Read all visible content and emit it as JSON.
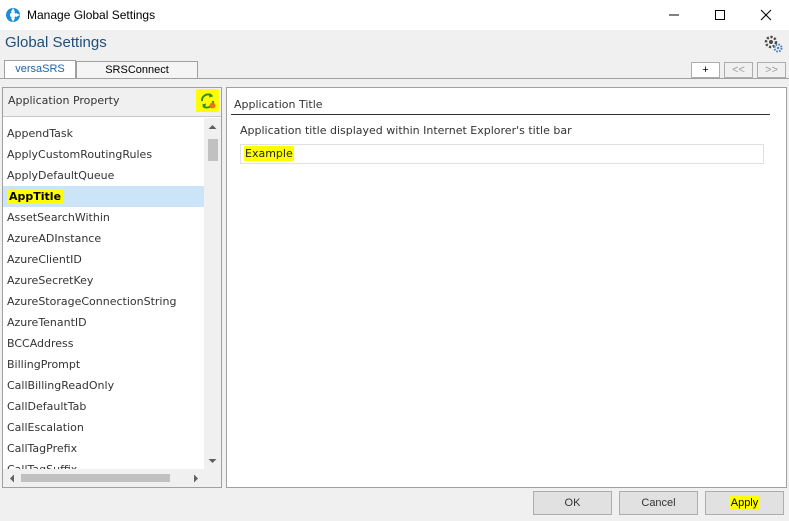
{
  "window": {
    "title": "Manage Global Settings",
    "icon": "versasrs-logo-icon",
    "controls": [
      "minimize-icon",
      "maximize-icon",
      "close-icon"
    ]
  },
  "header": {
    "title": "Global Settings",
    "gear_icon": "gear-settings-icon"
  },
  "tabs": [
    {
      "label": "versaSRS",
      "active": true
    },
    {
      "label": "SRSConnect",
      "active": false
    }
  ],
  "nav_buttons": {
    "add": "+",
    "prev": "<<",
    "next": ">>"
  },
  "left_panel": {
    "header_label": "Application Property",
    "refresh_icon": "refresh-icon",
    "items": [
      {
        "label": "AppendTask"
      },
      {
        "label": "ApplyCustomRoutingRules"
      },
      {
        "label": "ApplyDefaultQueue"
      },
      {
        "label": "AppTitle",
        "selected": true
      },
      {
        "label": "AssetSearchWithin"
      },
      {
        "label": "AzureADInstance"
      },
      {
        "label": "AzureClientID"
      },
      {
        "label": "AzureSecretKey"
      },
      {
        "label": "AzureStorageConnectionString"
      },
      {
        "label": "AzureTenantID"
      },
      {
        "label": "BCCAddress"
      },
      {
        "label": "BillingPrompt"
      },
      {
        "label": "CallBillingReadOnly"
      },
      {
        "label": "CallDefaultTab"
      },
      {
        "label": "CallEscalation"
      },
      {
        "label": "CallTagPrefix"
      },
      {
        "label": "CallTagSuffix"
      }
    ]
  },
  "right_panel": {
    "label": "Application Title",
    "description": "Application title displayed within Internet Explorer's title bar",
    "value": "Example"
  },
  "buttons": {
    "ok": "OK",
    "cancel": "Cancel",
    "apply": "Apply"
  },
  "colors": {
    "accent": "#1565a8",
    "title_text": "#1f4e79",
    "selection": "#cce4f7",
    "highlight": "#ffff00"
  }
}
